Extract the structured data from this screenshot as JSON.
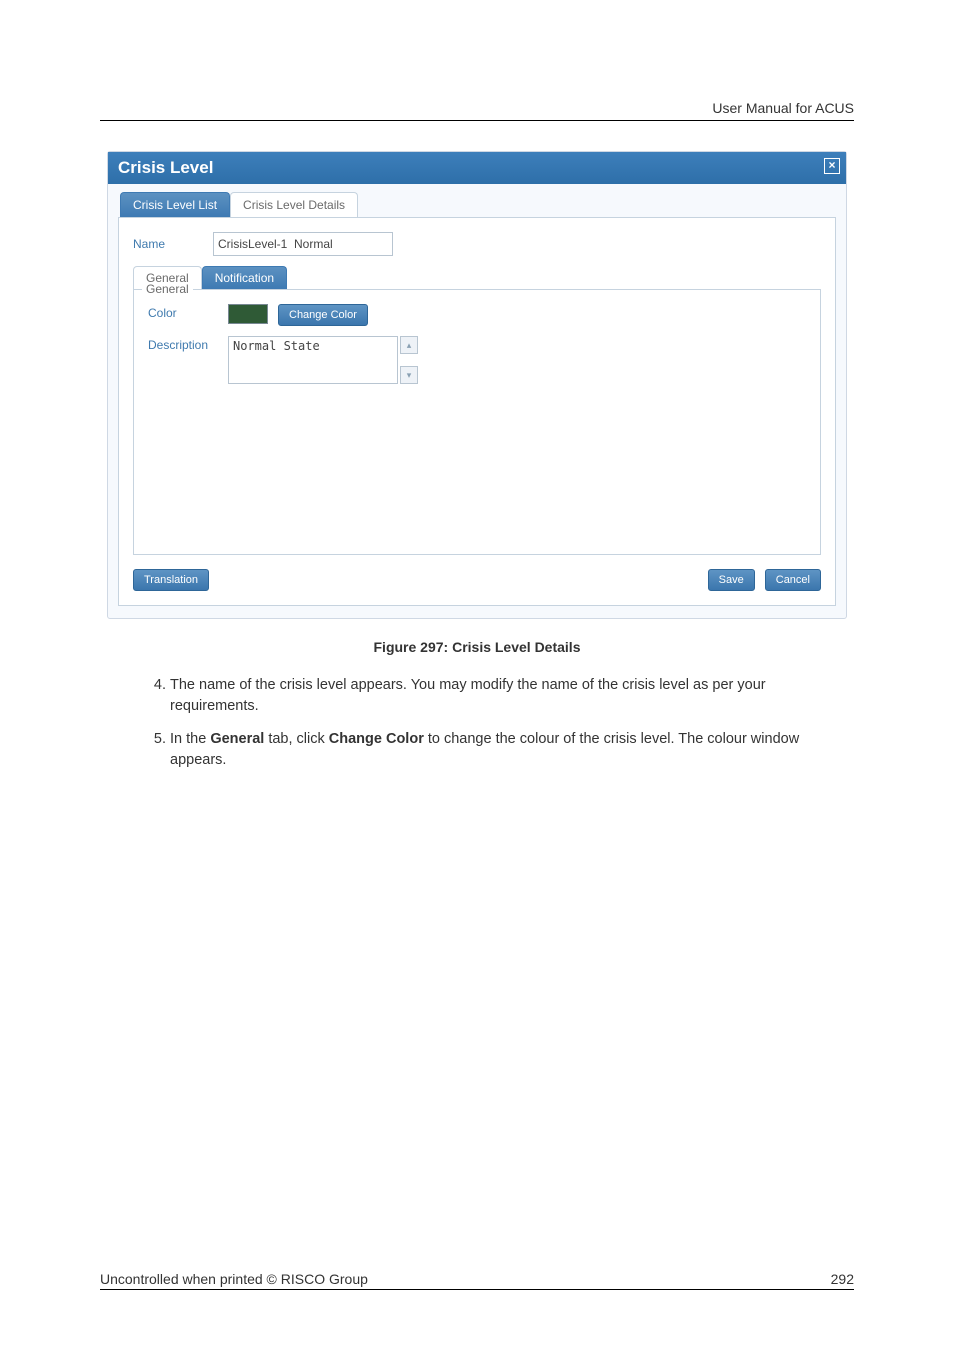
{
  "header": {
    "right_text": "User Manual for ACUS"
  },
  "dialog": {
    "title": "Crisis Level",
    "close_icon": "close-icon",
    "outer_tabs": [
      {
        "label": "Crisis Level List",
        "active": true
      },
      {
        "label": "Crisis Level Details",
        "active": false
      }
    ],
    "name_label": "Name",
    "name_value": "CrisisLevel-1  Normal",
    "inner_tabs": [
      {
        "label": "General",
        "active": false
      },
      {
        "label": "Notification",
        "active": true
      }
    ],
    "fieldset_legend": "General",
    "color_label": "Color",
    "color_value": "#2f5a36",
    "change_color_label": "Change Color",
    "description_label": "Description",
    "description_value": "Normal State",
    "translation_label": "Translation",
    "save_label": "Save",
    "cancel_label": "Cancel"
  },
  "figure_caption": "Figure 297: Crisis Level Details",
  "list": {
    "start": 4,
    "items": [
      {
        "plain_before": "The name of the crisis level appears. You may modify the name of the crisis level as per your requirements.",
        "bold1": "",
        "mid": "",
        "bold2": "",
        "plain_after": ""
      },
      {
        "plain_before": "In the ",
        "bold1": "General",
        "mid": " tab, click ",
        "bold2": "Change Color",
        "plain_after": " to change the colour of the crisis level. The colour window appears."
      }
    ]
  },
  "footer": {
    "left": "Uncontrolled when printed © RISCO Group",
    "right": "292"
  }
}
